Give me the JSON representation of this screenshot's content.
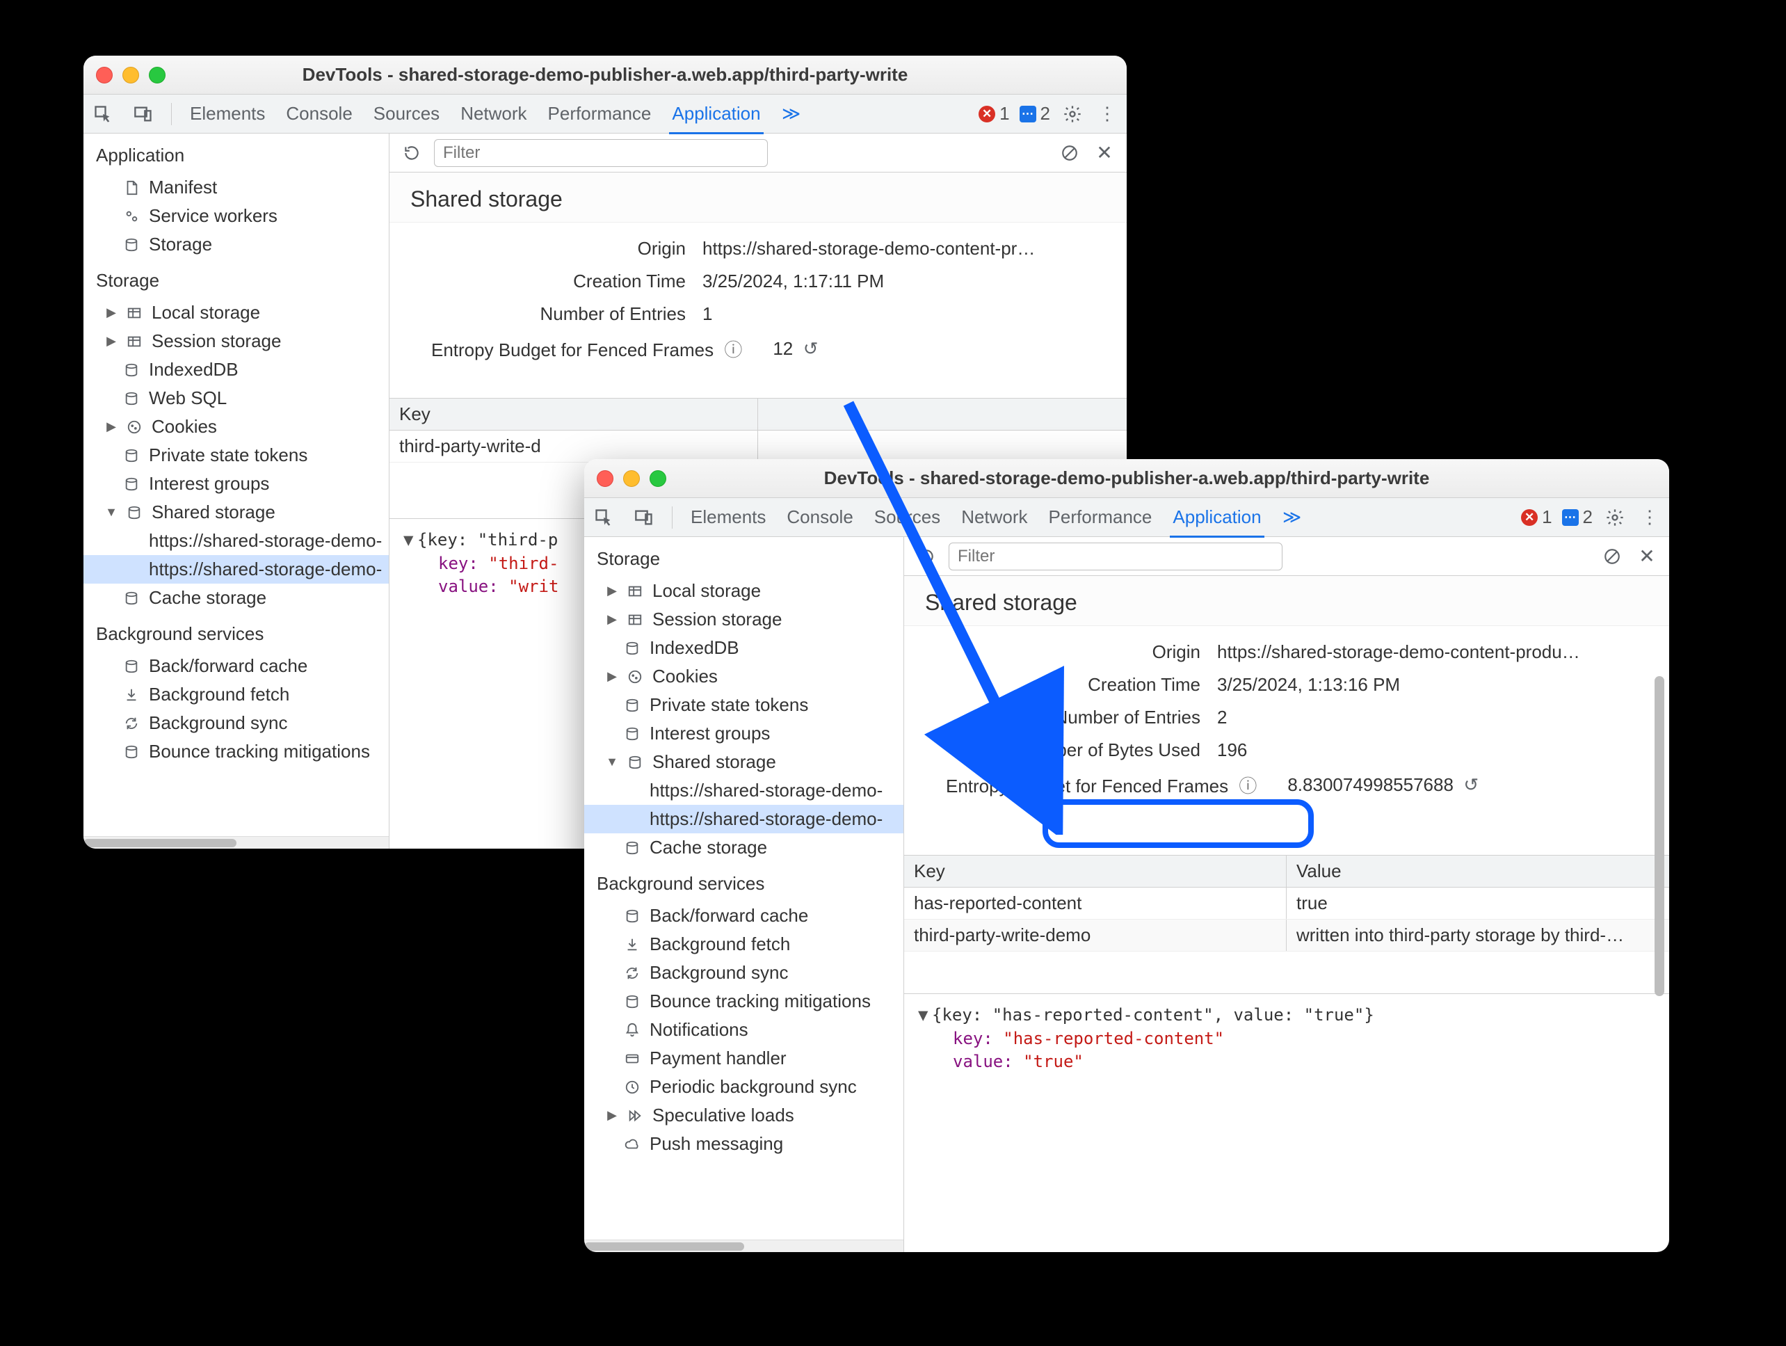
{
  "window_back": {
    "title": "DevTools - shared-storage-demo-publisher-a.web.app/third-party-write",
    "tabs": [
      "Elements",
      "Console",
      "Sources",
      "Network",
      "Performance",
      "Application"
    ],
    "active_tab": "Application",
    "errors": "1",
    "messages": "2",
    "sidebar": {
      "application_title": "Application",
      "app_items": [
        "Manifest",
        "Service workers",
        "Storage"
      ],
      "storage_title": "Storage",
      "storage_items": {
        "local": "Local storage",
        "session": "Session storage",
        "indexed": "IndexedDB",
        "websql": "Web SQL",
        "cookies": "Cookies",
        "pst": "Private state tokens",
        "ig": "Interest groups",
        "shared": "Shared storage",
        "shared_child1": "https://shared-storage-demo-",
        "shared_child2": "https://shared-storage-demo-",
        "cache": "Cache storage"
      },
      "bg_title": "Background services",
      "bg_items": [
        "Back/forward cache",
        "Background fetch",
        "Background sync",
        "Bounce tracking mitigations"
      ]
    },
    "filter_placeholder": "Filter",
    "panel": {
      "heading": "Shared storage",
      "rows": {
        "origin_k": "Origin",
        "origin_v": "https://shared-storage-demo-content-pr…",
        "ctime_k": "Creation Time",
        "ctime_v": "3/25/2024, 1:17:11 PM",
        "entries_k": "Number of Entries",
        "entries_v": "1",
        "entropy_k": "Entropy Budget for Fenced Frames",
        "entropy_v": "12"
      },
      "table": {
        "key_h": "Key",
        "row1_k": "third-party-write-d"
      },
      "detail": {
        "obj": "{key: \"third-p",
        "k1": "key: ",
        "v1": "\"third-",
        "k2": "value: ",
        "v2": "\"writ"
      }
    }
  },
  "window_front": {
    "title": "DevTools - shared-storage-demo-publisher-a.web.app/third-party-write",
    "tabs": [
      "Elements",
      "Console",
      "Sources",
      "Network",
      "Performance",
      "Application"
    ],
    "active_tab": "Application",
    "errors": "1",
    "messages": "2",
    "sidebar": {
      "storage_title": "Storage",
      "storage_items": {
        "local": "Local storage",
        "session": "Session storage",
        "indexed": "IndexedDB",
        "cookies": "Cookies",
        "pst": "Private state tokens",
        "ig": "Interest groups",
        "shared": "Shared storage",
        "shared_child1": "https://shared-storage-demo-",
        "shared_child2": "https://shared-storage-demo-",
        "cache": "Cache storage"
      },
      "bg_title": "Background services",
      "bg_items": [
        "Back/forward cache",
        "Background fetch",
        "Background sync",
        "Bounce tracking mitigations",
        "Notifications",
        "Payment handler",
        "Periodic background sync",
        "Speculative loads",
        "Push messaging"
      ]
    },
    "filter_placeholder": "Filter",
    "panel": {
      "heading": "Shared storage",
      "rows": {
        "origin_k": "Origin",
        "origin_v": "https://shared-storage-demo-content-produ…",
        "ctime_k": "Creation Time",
        "ctime_v": "3/25/2024, 1:13:16 PM",
        "entries_k": "Number of Entries",
        "entries_v": "2",
        "bytes_k": "Number of Bytes Used",
        "bytes_v": "196",
        "entropy_k": "Entropy Budget for Fenced Frames",
        "entropy_v": "8.830074998557688"
      },
      "table": {
        "key_h": "Key",
        "val_h": "Value",
        "row1_k": "has-reported-content",
        "row1_v": "true",
        "row2_k": "third-party-write-demo",
        "row2_v": "written into third-party storage by third-…"
      },
      "detail": {
        "obj": "{key: \"has-reported-content\", value: \"true\"}",
        "k1": "key: ",
        "v1": "\"has-reported-content\"",
        "k2": "value: ",
        "v2": "\"true\""
      }
    }
  }
}
